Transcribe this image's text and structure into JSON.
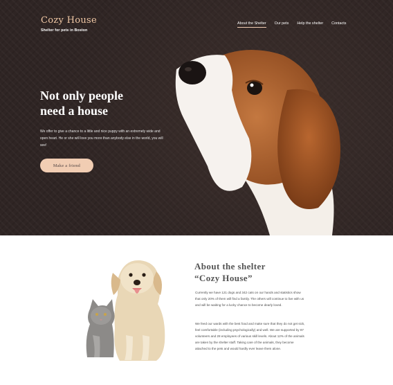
{
  "header": {
    "logo_title": "Cozy House",
    "logo_subtitle": "Shelter for pets in Boston",
    "nav": [
      {
        "label": "About the Shelter",
        "active": true
      },
      {
        "label": "Our pets",
        "active": false
      },
      {
        "label": "Help the shelter",
        "active": false
      },
      {
        "label": "Contacts",
        "active": false
      }
    ]
  },
  "hero": {
    "title": "Not only people need a house",
    "text": "We offer to give a chance to a little and nice puppy with an extremely wide and open heart. He or she will love you more than anybody else in the world, you will see!",
    "button_label": "Make a friend"
  },
  "about": {
    "title_line1": "About the shelter",
    "title_line2": "“Cozy House”",
    "paragraph1": "Currently we have 121 dogs and 342 cats on our hands and statistics show that only 20% of them will find a family. The others will continue to live with us and will be waiting for a lucky chance to become dearly loved.",
    "paragraph2": "We feed our wards with the best food and make sure that they do not get sick, feel comfortable (including psychologically) and well. We are supported by 87 volunteers and 28 employees of various skill levels. About 12% of the animals are taken by the shelter staff. Taking care of the animals, they become attached to the pets and would hardly ever leave them alone."
  },
  "colors": {
    "accent": "#f1cdb3",
    "logo": "#f2c9a6",
    "hero_bg": "#2f2524"
  }
}
